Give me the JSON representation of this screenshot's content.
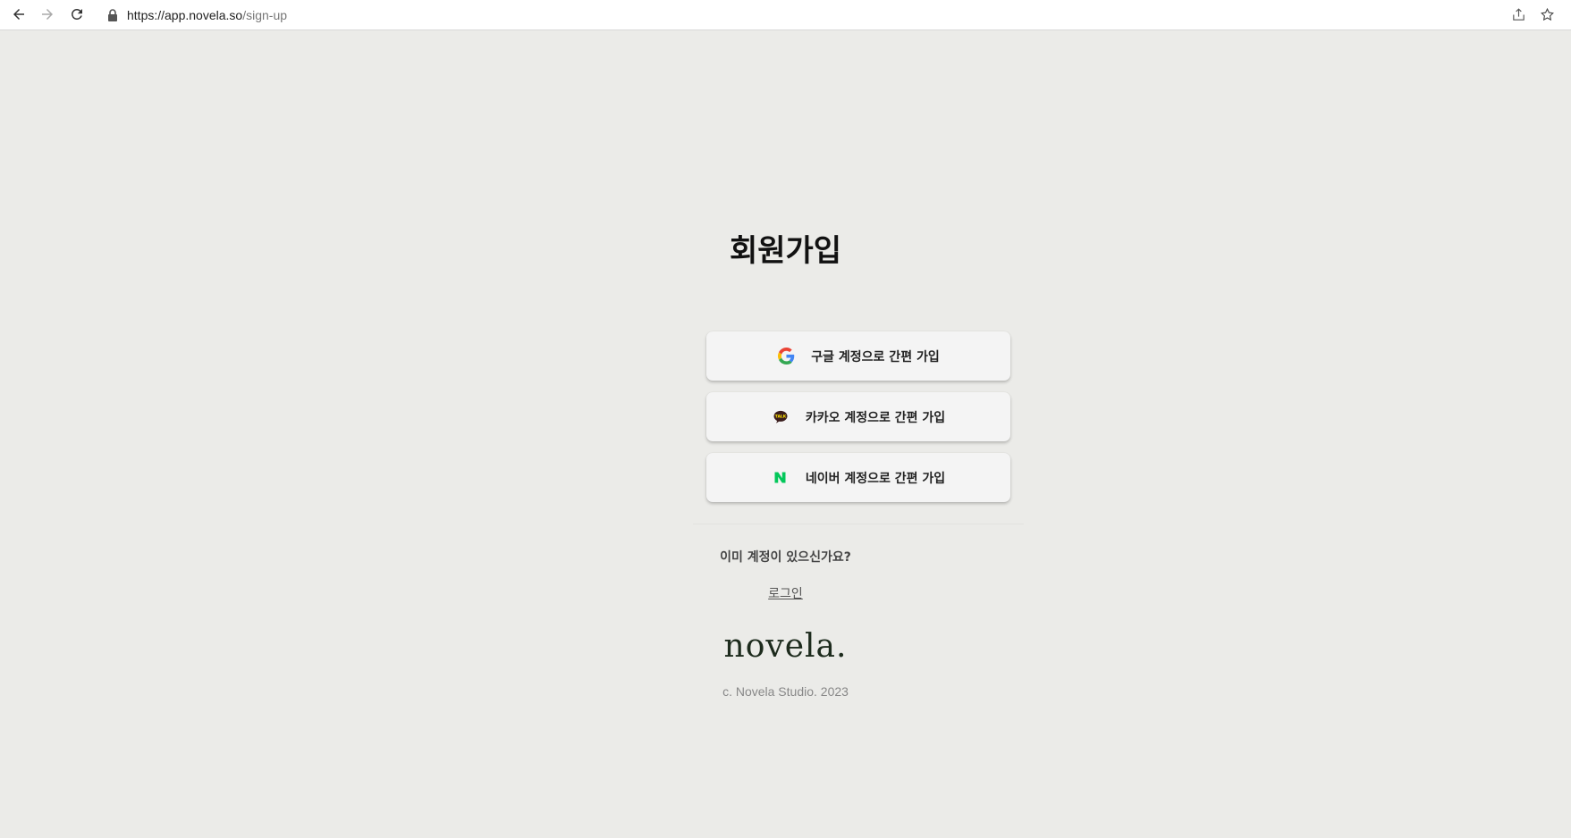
{
  "browser": {
    "url_host": "https://app.novela.so",
    "url_path": "/sign-up"
  },
  "page": {
    "title": "회원가입",
    "buttons": [
      {
        "label": "구글 계정으로 간편 가입",
        "icon": "google-icon"
      },
      {
        "label": "카카오 계정으로 간편 가입",
        "icon": "kakao-talk-icon"
      },
      {
        "label": "네이버 계정으로 간편 가입",
        "icon": "naver-icon"
      }
    ],
    "already_text": "이미 계정이 있으신가요?",
    "login_label": "로그인",
    "logo_text": "novela.",
    "copyright": "c. Novela Studio. 2023"
  },
  "colors": {
    "background": "#ebebe8",
    "button_bg": "#f4f4f4",
    "naver_green": "#03c75a",
    "kakao_yellow": "#fee500",
    "logo_color": "#1d2b1d"
  }
}
